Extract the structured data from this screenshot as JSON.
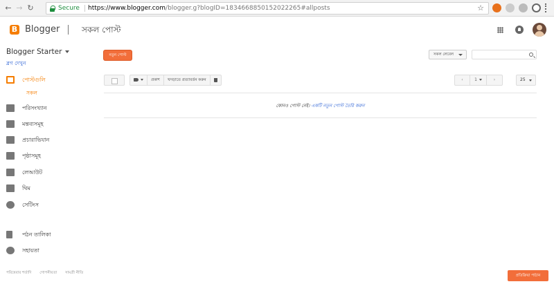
{
  "browser": {
    "secure_label": "Secure",
    "url_host": "https://www.blogger.com",
    "url_rest": "/blogger.g?blogID=1834668850152022265#allposts"
  },
  "header": {
    "brand": "Blogger",
    "page_title": "সকল পোস্ট"
  },
  "sidebar": {
    "blog_name": "Blogger Starter",
    "view_blog": "ব্লগ দেখুন",
    "items": [
      {
        "label": "পোস্টগুলি",
        "icon": "posts-icon"
      },
      {
        "label": "সকল",
        "icon": ""
      },
      {
        "label": "পরিসংখ্যান",
        "icon": "stats-icon"
      },
      {
        "label": "মন্তব্যসমূহ",
        "icon": "comments-icon"
      },
      {
        "label": "প্রচারাভিযান",
        "icon": "campaigns-icon"
      },
      {
        "label": "পৃষ্ঠাসমূহ",
        "icon": "pages-icon"
      },
      {
        "label": "লেআউট",
        "icon": "layout-icon"
      },
      {
        "label": "থিম",
        "icon": "theme-icon"
      },
      {
        "label": "সেটিংস",
        "icon": "gear-icon"
      },
      {
        "label": "পঠন তালিকা",
        "icon": "bookmark-icon"
      },
      {
        "label": "সহায়তা",
        "icon": "help-icon"
      }
    ],
    "footer": [
      "পরিষেবার শর্তাদি",
      "গোপনীয়তা",
      "সামগ্রী নীতি"
    ]
  },
  "main": {
    "new_post": "নতুন পোস্ট",
    "label_filter": "সকল লেবেল",
    "publish": "প্রকাশ",
    "revert": "খসড়াতে প্রত্যাবর্তন করুন",
    "page_number": "1",
    "per_page": "25",
    "empty_text": "কোনও পোস্ট নেই।",
    "empty_link": "একটি নতুন পোস্ট তৈরি করুন"
  },
  "feedback": "প্রতিক্রিয়া পাঠান",
  "colors": {
    "accent": "#f57d00",
    "button": "#f26e3a",
    "link": "#3367d6"
  }
}
